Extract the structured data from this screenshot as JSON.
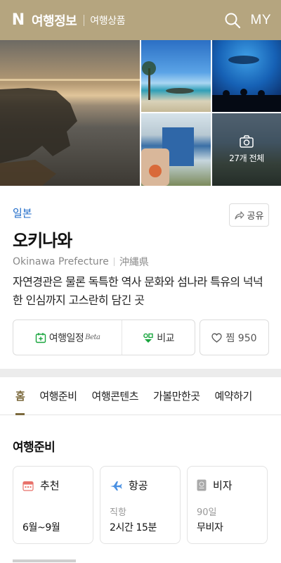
{
  "header": {
    "logo": "N",
    "title": "여행정보",
    "subtitle": "여행상품",
    "my_label": "MY",
    "background": "#b5a57f"
  },
  "gallery": {
    "more_label": "27개 전체"
  },
  "place": {
    "country": "일본",
    "share_label": "공유",
    "name": "오키나와",
    "name_en": "Okinawa Prefecture",
    "name_local": "沖縄県",
    "description": "자연경관은 물론 독특한 역사 문화와 섬나라 특유의 넉넉한 인심까지 고스란히 담긴 곳"
  },
  "actions": {
    "itinerary_label": "여행일정",
    "itinerary_beta": "Beta",
    "compare_label": "비교",
    "pick_label": "찜 950"
  },
  "tabs": [
    {
      "label": "홈",
      "active": true
    },
    {
      "label": "여행준비",
      "active": false
    },
    {
      "label": "여행콘텐츠",
      "active": false
    },
    {
      "label": "가볼만한곳",
      "active": false
    },
    {
      "label": "예약하기",
      "active": false
    }
  ],
  "prep": {
    "title": "여행준비",
    "cards": [
      {
        "icon": "calendar-icon",
        "label": "추천",
        "sub": "",
        "value": "6월~9월"
      },
      {
        "icon": "airplane-icon",
        "label": "항공",
        "sub": "직항",
        "value": "2시간 15분"
      },
      {
        "icon": "passport-icon",
        "label": "비자",
        "sub": "90일",
        "value": "무비자"
      }
    ]
  },
  "colors": {
    "accent": "#7c6a3e",
    "link": "#1f6bc9",
    "green": "#19a53e"
  }
}
